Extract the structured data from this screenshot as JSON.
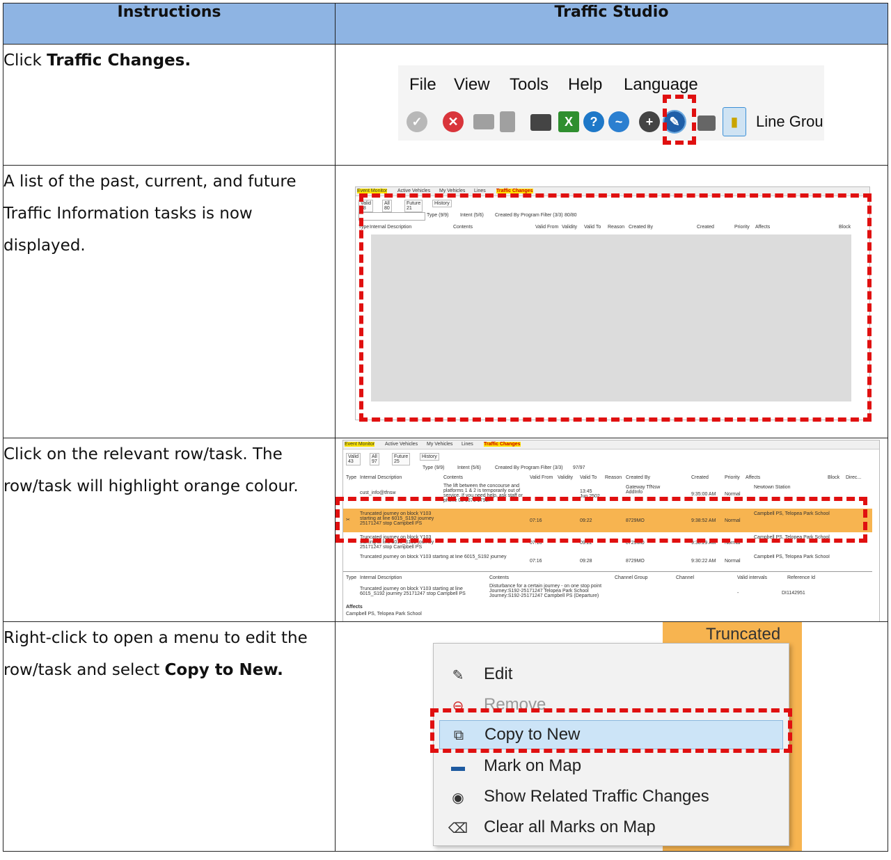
{
  "headers": {
    "instructions": "Instructions",
    "studio": "Traffic Studio"
  },
  "rows": [
    {
      "text_pre": "Click ",
      "bold": "Traffic Changes.",
      "text_post": ""
    },
    {
      "text_pre": "A list of the past, current, and future Traffic Information tasks is now displayed.",
      "bold": "",
      "text_post": ""
    },
    {
      "text_pre": "Click on the relevant row/task. The row/task will highlight orange colour.",
      "bold": "",
      "text_post": ""
    },
    {
      "text_pre": "Right-click to open a menu to edit the row/task and select ",
      "bold": "Copy to New.",
      "text_post": ""
    }
  ],
  "toolbar": {
    "menu": [
      "File",
      "View",
      "Tools",
      "Help",
      "Language"
    ],
    "line_group": "Line Grou"
  },
  "app_tabs": {
    "event": "Event Monitor",
    "active": "Active Vehicles",
    "my": "My Vehicles",
    "lines": "Lines",
    "traffic": "Traffic Changes"
  },
  "shot2": {
    "valid": "Valid 38",
    "all": "All 80",
    "future": "Future 21",
    "history": "History",
    "type": "Type (9/9)",
    "intent": "Intent (5/6)",
    "created_by": "Created By Program Filter (3/3)",
    "count": "80/80",
    "cols": [
      "Type",
      "Internal Description",
      "Contents",
      "Valid From",
      "Validity",
      "Valid To",
      "Reason",
      "Created By",
      "Created",
      "Priority",
      "Affects",
      "Block"
    ]
  },
  "shot3": {
    "valid": "Valid 43",
    "all": "All 97",
    "future": "Future 25",
    "history": "History",
    "type": "Type (9/9)",
    "intent": "Intent (5/6)",
    "created_by": "Created By Program Filter (3/3)",
    "count": "97/97",
    "cols": [
      "Type",
      "Internal Description",
      "Contents",
      "Valid From",
      "Validity",
      "Valid To",
      "Reason",
      "Created By",
      "Created",
      "Priority",
      "Affects",
      "Block",
      "Direc..."
    ],
    "row1": {
      "desc": "cust_info@tfnsw",
      "contents": "The lift between the concourse and platforms 1 & 2 is temporarily out of service. If you need help, ask staff or phone 02 9379 1790.",
      "valid_to": "13:45 Jun 2502",
      "created_by": "Gateway TfNsw AddInfo",
      "created": "9:35:00 AM",
      "priority": "Normal",
      "affects": "Newtown Station"
    },
    "row2": {
      "desc": "Truncated journey on block Y103 starting at line 6015_S192 journey 25171247 stop Campbell PS",
      "valid_from": "07:16",
      "valid_to": "09:22",
      "created_by": "8729MO",
      "created": "9:38:52 AM",
      "priority": "Normal",
      "affects": "Campbell PS, Telopea Park School"
    },
    "row3": {
      "desc": "Truncated journey on block Y103 starting at line 6015_S192 journey 25171247 stop Campbell PS",
      "valid_from": "07:16",
      "valid_to": "09:22",
      "created_by": "8729MO",
      "created": "9:38:29 AM",
      "priority": "Normal",
      "affects": "Campbell PS, Telopea Park School"
    },
    "row4": {
      "desc": "Truncated journey on block Y103 starting at line 6015_S192 journey",
      "valid_from": "07:16",
      "valid_to": "09:28",
      "created_by": "8729MO",
      "created": "9:30:22 AM",
      "priority": "Normal",
      "affects": "Campbell PS, Telopea Park School"
    },
    "detail_cols": [
      "Type",
      "Internal Description",
      "Contents",
      "Channel Group",
      "Channel",
      "Valid intervals",
      "Reference Id"
    ],
    "detail": {
      "desc": "Truncated journey on block Y103 starting at line 6015_S192 journey 25171247 stop Campbell PS",
      "contents": "Disturbance for a certain journey - on one stop point Journey:S192-25171247 Telopea Park School Journey:S192-25171247 Campbell PS (Departure)",
      "valid": "-",
      "ref": "DI1142951"
    },
    "affects_label": "Affects",
    "affects_value": "Campbell PS, Telopea Park School"
  },
  "context_menu": [
    "Edit",
    "Remove",
    "Copy to New",
    "Mark on Map",
    "Show Related Traffic Changes",
    "Clear all Marks on Map"
  ],
  "bg_text": "Truncated",
  "colors": {
    "header": "#8eb4e3",
    "dash": "#e01010",
    "highlight": "#f7b450",
    "menu_sel": "#cce4f7"
  }
}
